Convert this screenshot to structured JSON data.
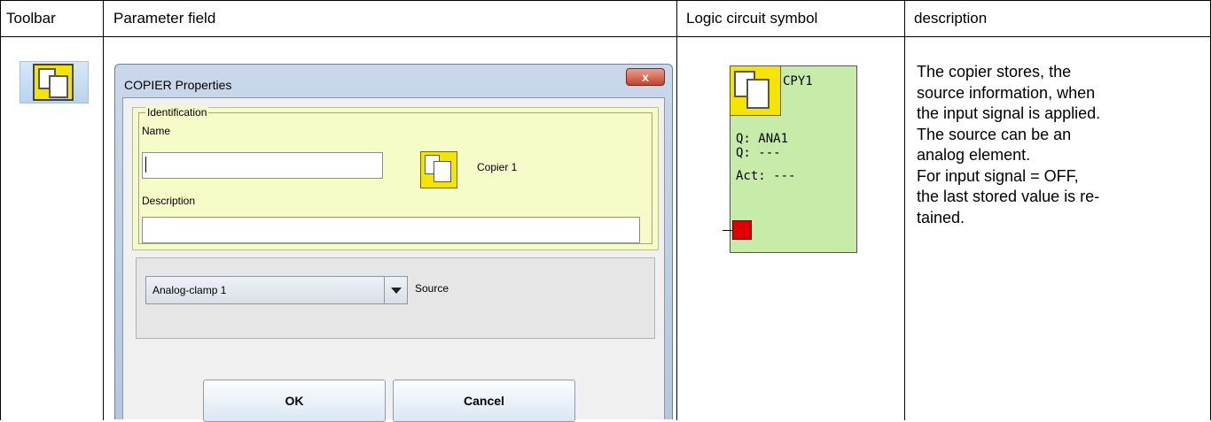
{
  "headers": {
    "toolbar": "Toolbar",
    "parameter_field": "Parameter field",
    "logic_symbol": "Logic circuit symbol",
    "description": "description"
  },
  "dialog": {
    "title": "COPIER Properties",
    "close_glyph": "x",
    "identification_legend": "Identification",
    "name_label": "Name",
    "name_value": "",
    "element_caption": "Copier 1",
    "description_label": "Description",
    "description_value": "",
    "source_value": "Analog-clamp  1",
    "source_label": "Source",
    "ok_label": "OK",
    "cancel_label": "Cancel"
  },
  "logic_symbol": {
    "name": "CPY1",
    "line1": "Q: ANA1",
    "line2": "Q: ---",
    "line3": "Act: ---",
    "block_color": "#c7ecaa",
    "icon_color": "#f4e400",
    "input_color": "#e00000"
  },
  "description_lines": [
    "The copier stores, the",
    "source information, when",
    "the input signal is applied.",
    "The source can be an",
    "analog element.",
    "For input signal = OFF,",
    "the last stored value is re-",
    "tained."
  ],
  "icons": {
    "toolbar_icon": "copy-icon",
    "dialog_icon": "copy-icon",
    "symbol_icon": "copy-icon"
  }
}
